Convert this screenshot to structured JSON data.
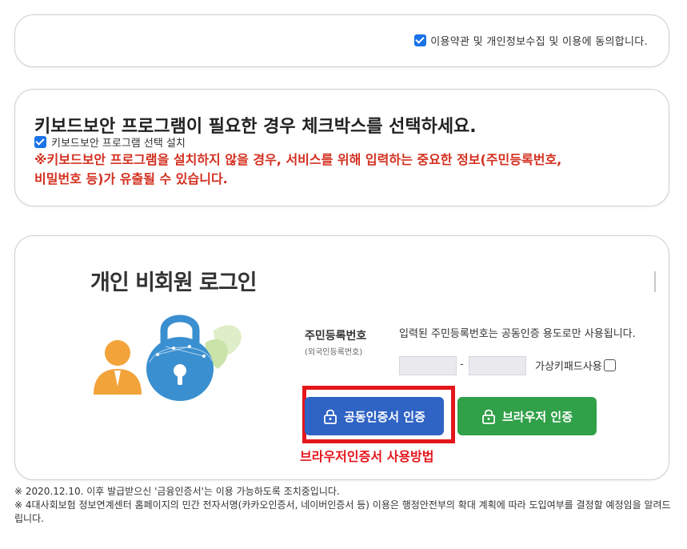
{
  "agree": {
    "checked": true,
    "label": "이용약관 및 개인정보수집 및 이용에 동의합니다."
  },
  "keyboard_security": {
    "title": "키보드보안 프로그램이 필요한 경우 체크박스를 선택하세요.",
    "checkbox_checked": true,
    "checkbox_label": "키보드보안 프로그램 선택 설치",
    "warning_line1": "※키보드보안 프로그램을 설치하지 않을 경우, 서비스를 위해 입력하는 중요한 정보(주민등록번호,",
    "warning_line2": "비밀번호 등)가 유출될 수 있습니다."
  },
  "login": {
    "title": "개인 비회원 로그인",
    "rrn_label": "주민등록번호",
    "rrn_sublabel": "(외국인등록번호)",
    "rrn_note": "입력된 주민등록번호는 공동인증 용도로만 사용됩니다.",
    "rrn_front_value": "",
    "rrn_back_value": "",
    "rrn_separator": "-",
    "virtual_keypad_label": "가상키패드사용",
    "virtual_keypad_checked": false,
    "cert_button_label": "공동인증서 인증",
    "browser_button_label": "브라우저 인증",
    "howto_link": "브라우저인증서 사용방법"
  },
  "notes": {
    "line1": "※ 2020.12.10. 이후 발급받으신 '금융인증서'는 이용 가능하도록 조치중입니다.",
    "line2": "※ 4대사회보험 정보연계센터 홈페이지의 민간 전자서명(카카오인증서, 네이버인증서 등) 이용은 행정안전부의 확대 계획에 따라 도입여부를 결정할 예정임을 알려드립니다."
  },
  "colors": {
    "checkbox_blue": "#1a73e8",
    "warning_red": "#d32f1f",
    "highlight_red": "#e4161c",
    "cert_button": "#2f63c4",
    "browser_button": "#30a049"
  }
}
